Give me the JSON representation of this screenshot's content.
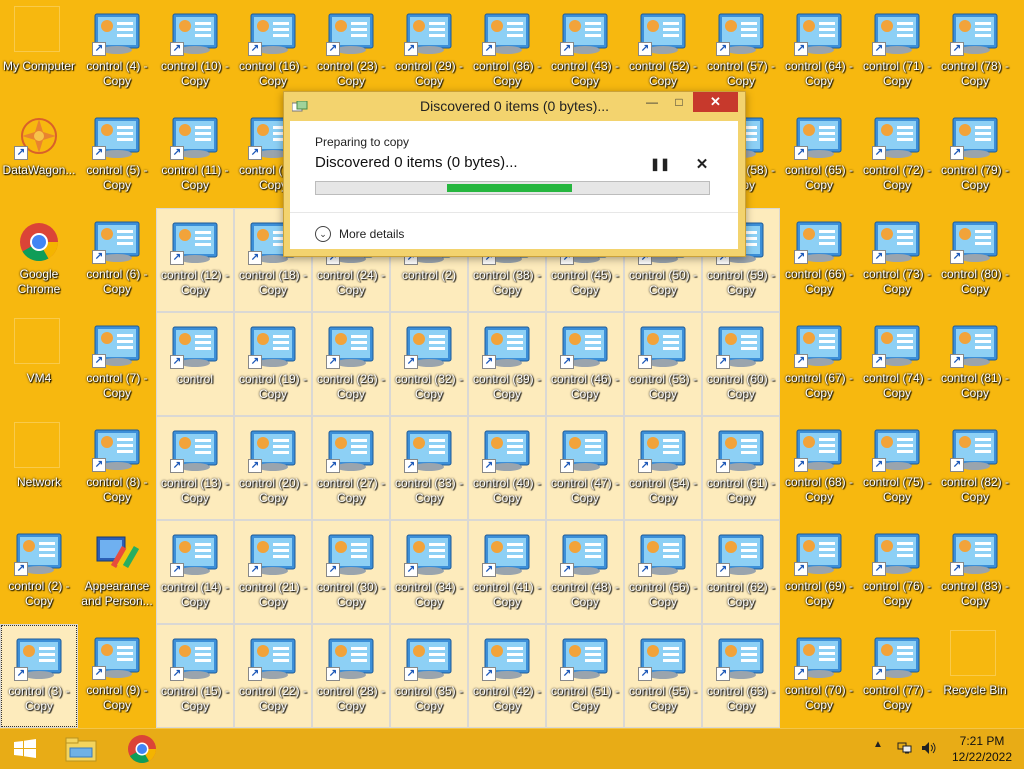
{
  "desktop": {
    "icons": [
      {
        "label": "My Computer",
        "type": "blank",
        "col": 0,
        "row": 0
      },
      {
        "label": "DataWagon...",
        "type": "datawagon",
        "col": 0,
        "row": 1
      },
      {
        "label": "Google\nChrome",
        "type": "chrome",
        "col": 0,
        "row": 2
      },
      {
        "label": "VM4",
        "type": "blank",
        "col": 0,
        "row": 3
      },
      {
        "label": "Network",
        "type": "blank",
        "col": 0,
        "row": 4
      },
      {
        "label": "control (2) -\nCopy",
        "type": "cp",
        "col": 0,
        "row": 5
      },
      {
        "label": "control (3) -\nCopy",
        "type": "cp",
        "col": 0,
        "row": 6,
        "selected": true,
        "focused": true
      },
      {
        "label": "control (4) -\nCopy",
        "type": "cp",
        "col": 1,
        "row": 0
      },
      {
        "label": "control (5) -\nCopy",
        "type": "cp",
        "col": 1,
        "row": 1
      },
      {
        "label": "control (6) -\nCopy",
        "type": "cp",
        "col": 1,
        "row": 2
      },
      {
        "label": "control (7) -\nCopy",
        "type": "cp",
        "col": 1,
        "row": 3
      },
      {
        "label": "control (8) -\nCopy",
        "type": "cp",
        "col": 1,
        "row": 4
      },
      {
        "label": "Appearance\nand Person...",
        "type": "appearance",
        "col": 1,
        "row": 5
      },
      {
        "label": "control (9) -\nCopy",
        "type": "cp",
        "col": 1,
        "row": 6
      },
      {
        "label": "control (10) -\nCopy",
        "type": "cp",
        "col": 2,
        "row": 0
      },
      {
        "label": "control (11) -\nCopy",
        "type": "cp",
        "col": 2,
        "row": 1
      },
      {
        "label": "control (12) -\nCopy",
        "type": "cp",
        "col": 2,
        "row": 2,
        "selected": true
      },
      {
        "label": "control",
        "type": "cp",
        "col": 2,
        "row": 3,
        "selected": true
      },
      {
        "label": "control (13) -\nCopy",
        "type": "cp",
        "col": 2,
        "row": 4,
        "selected": true
      },
      {
        "label": "control (14) -\nCopy",
        "type": "cp",
        "col": 2,
        "row": 5,
        "selected": true
      },
      {
        "label": "control (15) -\nCopy",
        "type": "cp",
        "col": 2,
        "row": 6,
        "selected": true
      },
      {
        "label": "control (16) -\nCopy",
        "type": "cp",
        "col": 3,
        "row": 0
      },
      {
        "label": "control (17) -\nCopy",
        "type": "cp",
        "col": 3,
        "row": 1
      },
      {
        "label": "control (18) -\nCopy",
        "type": "cp",
        "col": 3,
        "row": 2,
        "selected": true
      },
      {
        "label": "control (19) -\nCopy",
        "type": "cp",
        "col": 3,
        "row": 3,
        "selected": true
      },
      {
        "label": "control (20) -\nCopy",
        "type": "cp",
        "col": 3,
        "row": 4,
        "selected": true
      },
      {
        "label": "control (21) -\nCopy",
        "type": "cp",
        "col": 3,
        "row": 5,
        "selected": true
      },
      {
        "label": "control (22) -\nCopy",
        "type": "cp",
        "col": 3,
        "row": 6,
        "selected": true
      },
      {
        "label": "control (23) -\nCopy",
        "type": "cp",
        "col": 4,
        "row": 0
      },
      {
        "label": "control (24) -\nCopy",
        "type": "cp",
        "col": 4,
        "row": 2,
        "selected": true
      },
      {
        "label": "control (26) -\nCopy",
        "type": "cp",
        "col": 4,
        "row": 3,
        "selected": true
      },
      {
        "label": "control (27) -\nCopy",
        "type": "cp",
        "col": 4,
        "row": 4,
        "selected": true
      },
      {
        "label": "control (30) -\nCopy",
        "type": "cp",
        "col": 4,
        "row": 5,
        "selected": true
      },
      {
        "label": "control (28) -\nCopy",
        "type": "cp",
        "col": 4,
        "row": 6,
        "selected": true
      },
      {
        "label": "control (29) -\nCopy",
        "type": "cp",
        "col": 5,
        "row": 0
      },
      {
        "label": "control (2)",
        "type": "cp",
        "col": 5,
        "row": 2,
        "selected": true
      },
      {
        "label": "control (32) -\nCopy",
        "type": "cp",
        "col": 5,
        "row": 3,
        "selected": true
      },
      {
        "label": "control (33) -\nCopy",
        "type": "cp",
        "col": 5,
        "row": 4,
        "selected": true
      },
      {
        "label": "control (34) -\nCopy",
        "type": "cp",
        "col": 5,
        "row": 5,
        "selected": true
      },
      {
        "label": "control (35) -\nCopy",
        "type": "cp",
        "col": 5,
        "row": 6,
        "selected": true
      },
      {
        "label": "control (36) -\nCopy",
        "type": "cp",
        "col": 6,
        "row": 0
      },
      {
        "label": "control (38) -\nCopy",
        "type": "cp",
        "col": 6,
        "row": 2,
        "selected": true
      },
      {
        "label": "control (39) -\nCopy",
        "type": "cp",
        "col": 6,
        "row": 3,
        "selected": true
      },
      {
        "label": "control (40) -\nCopy",
        "type": "cp",
        "col": 6,
        "row": 4,
        "selected": true
      },
      {
        "label": "control (41) -\nCopy",
        "type": "cp",
        "col": 6,
        "row": 5,
        "selected": true
      },
      {
        "label": "control (42) -\nCopy",
        "type": "cp",
        "col": 6,
        "row": 6,
        "selected": true
      },
      {
        "label": "control (43) -\nCopy",
        "type": "cp",
        "col": 7,
        "row": 0
      },
      {
        "label": "control (45) -\nCopy",
        "type": "cp",
        "col": 7,
        "row": 2,
        "selected": true
      },
      {
        "label": "control (46) -\nCopy",
        "type": "cp",
        "col": 7,
        "row": 3,
        "selected": true
      },
      {
        "label": "control (47) -\nCopy",
        "type": "cp",
        "col": 7,
        "row": 4,
        "selected": true
      },
      {
        "label": "control (48) -\nCopy",
        "type": "cp",
        "col": 7,
        "row": 5,
        "selected": true
      },
      {
        "label": "control (51) -\nCopy",
        "type": "cp",
        "col": 7,
        "row": 6,
        "selected": true
      },
      {
        "label": "control (52) -\nCopy",
        "type": "cp",
        "col": 8,
        "row": 0
      },
      {
        "label": "control (50) -\nCopy",
        "type": "cp",
        "col": 8,
        "row": 2,
        "selected": true
      },
      {
        "label": "control (53) -\nCopy",
        "type": "cp",
        "col": 8,
        "row": 3,
        "selected": true
      },
      {
        "label": "control (54) -\nCopy",
        "type": "cp",
        "col": 8,
        "row": 4,
        "selected": true
      },
      {
        "label": "control (56) -\nCopy",
        "type": "cp",
        "col": 8,
        "row": 5,
        "selected": true
      },
      {
        "label": "control (55) -\nCopy",
        "type": "cp",
        "col": 8,
        "row": 6,
        "selected": true
      },
      {
        "label": "control (57) -\nCopy",
        "type": "cp",
        "col": 9,
        "row": 0
      },
      {
        "label": "control (58) -\nCopy",
        "type": "cp",
        "col": 9,
        "row": 1
      },
      {
        "label": "control (59) -\nCopy",
        "type": "cp",
        "col": 9,
        "row": 2,
        "selected": true
      },
      {
        "label": "control (60) -\nCopy",
        "type": "cp",
        "col": 9,
        "row": 3,
        "selected": true
      },
      {
        "label": "control (61) -\nCopy",
        "type": "cp",
        "col": 9,
        "row": 4,
        "selected": true
      },
      {
        "label": "control (62) -\nCopy",
        "type": "cp",
        "col": 9,
        "row": 5,
        "selected": true
      },
      {
        "label": "control (63) -\nCopy",
        "type": "cp",
        "col": 9,
        "row": 6,
        "selected": true
      },
      {
        "label": "control (64) -\nCopy",
        "type": "cp",
        "col": 10,
        "row": 0
      },
      {
        "label": "control (65) -\nCopy",
        "type": "cp",
        "col": 10,
        "row": 1
      },
      {
        "label": "control (66) -\nCopy",
        "type": "cp",
        "col": 10,
        "row": 2
      },
      {
        "label": "control (67) -\nCopy",
        "type": "cp",
        "col": 10,
        "row": 3
      },
      {
        "label": "control (68) -\nCopy",
        "type": "cp",
        "col": 10,
        "row": 4
      },
      {
        "label": "control (69) -\nCopy",
        "type": "cp",
        "col": 10,
        "row": 5
      },
      {
        "label": "control (70) -\nCopy",
        "type": "cp",
        "col": 10,
        "row": 6
      },
      {
        "label": "control (71) -\nCopy",
        "type": "cp",
        "col": 11,
        "row": 0
      },
      {
        "label": "control (72) -\nCopy",
        "type": "cp",
        "col": 11,
        "row": 1
      },
      {
        "label": "control (73) -\nCopy",
        "type": "cp",
        "col": 11,
        "row": 2
      },
      {
        "label": "control (74) -\nCopy",
        "type": "cp",
        "col": 11,
        "row": 3
      },
      {
        "label": "control (75) -\nCopy",
        "type": "cp",
        "col": 11,
        "row": 4
      },
      {
        "label": "control (76) -\nCopy",
        "type": "cp",
        "col": 11,
        "row": 5
      },
      {
        "label": "control (77) -\nCopy",
        "type": "cp",
        "col": 11,
        "row": 6
      },
      {
        "label": "control (78) -\nCopy",
        "type": "cp",
        "col": 12,
        "row": 0
      },
      {
        "label": "control (79) -\nCopy",
        "type": "cp",
        "col": 12,
        "row": 1
      },
      {
        "label": "control (80) -\nCopy",
        "type": "cp",
        "col": 12,
        "row": 2
      },
      {
        "label": "control (81) -\nCopy",
        "type": "cp",
        "col": 12,
        "row": 3
      },
      {
        "label": "control (82) -\nCopy",
        "type": "cp",
        "col": 12,
        "row": 4
      },
      {
        "label": "control (83) -\nCopy",
        "type": "cp",
        "col": 12,
        "row": 5
      },
      {
        "label": "Recycle Bin",
        "type": "blank",
        "col": 12,
        "row": 6
      }
    ]
  },
  "copy_dialog": {
    "title": "Discovered 0 items (0 bytes)...",
    "preparing": "Preparing to copy",
    "status": "Discovered 0 items (0 bytes)...",
    "more_details": "More details",
    "progress_start": 0.33,
    "progress_end": 0.65
  },
  "taskbar": {
    "apps": [
      "start-icon",
      "file-explorer-icon",
      "chrome-icon"
    ],
    "clock_time": "7:21 PM",
    "clock_date": "12/22/2022"
  },
  "colors": {
    "desktop": "#f7b80f",
    "progress": "#26b63f",
    "close": "#c7392c"
  }
}
